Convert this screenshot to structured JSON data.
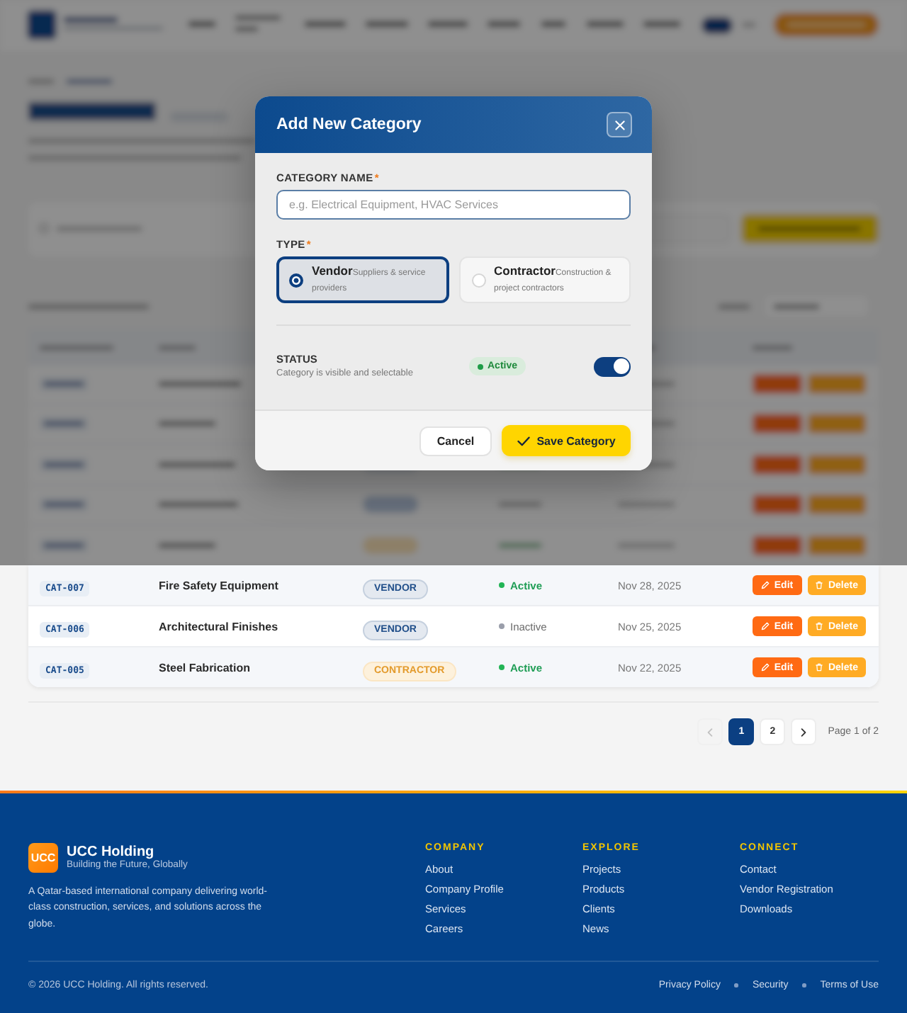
{
  "modal": {
    "title": "Add New Category",
    "name_field": {
      "label": "CATEGORY NAME",
      "required_mark": "*",
      "placeholder": "e.g. Electrical Equipment, HVAC Services"
    },
    "type_field": {
      "label": "TYPE",
      "required_mark": "*",
      "options": [
        {
          "title": "Vendor",
          "description": "Suppliers & service providers",
          "selected": true
        },
        {
          "title": "Contractor",
          "description": "Construction & project contractors",
          "selected": false
        }
      ]
    },
    "status": {
      "label": "STATUS",
      "hint": "Category is visible and selectable",
      "badge": "Active",
      "on": true
    },
    "buttons": [
      {
        "label": "Cancel",
        "kind": "secondary"
      },
      {
        "label": "Save Category",
        "kind": "primary"
      }
    ]
  },
  "table": {
    "rows": [
      {
        "id": "CAT-007",
        "name": "Fire Safety Equipment",
        "type": {
          "label": "VENDOR",
          "kind": "vendor"
        },
        "status": {
          "label": "Active",
          "active": true
        },
        "created": "Nov 28, 2025",
        "actions": [
          {
            "label": "Edit",
            "kind": "edit"
          },
          {
            "label": "Delete",
            "kind": "delete"
          }
        ]
      },
      {
        "id": "CAT-006",
        "name": "Architectural Finishes",
        "type": {
          "label": "VENDOR",
          "kind": "vendor"
        },
        "status": {
          "label": "Inactive",
          "active": false
        },
        "created": "Nov 25, 2025",
        "actions": [
          {
            "label": "Edit",
            "kind": "edit"
          },
          {
            "label": "Delete",
            "kind": "delete"
          }
        ]
      },
      {
        "id": "CAT-005",
        "name": "Steel Fabrication",
        "type": {
          "label": "CONTRACTOR",
          "kind": "contractor"
        },
        "status": {
          "label": "Active",
          "active": true
        },
        "created": "Nov 22, 2025",
        "actions": [
          {
            "label": "Edit",
            "kind": "edit"
          },
          {
            "label": "Delete",
            "kind": "delete"
          }
        ]
      }
    ]
  },
  "pagination": {
    "previous": {
      "disabled": true
    },
    "pages": [
      {
        "label": "1",
        "selected": true
      },
      {
        "label": "2",
        "selected": false
      }
    ],
    "next": {
      "disabled": false
    },
    "summary": "Page 1 of 2"
  },
  "footer": {
    "brand": {
      "logo": "UCC",
      "name": "UCC Holding",
      "tagline": "Building the Future, Globally"
    },
    "description": "A Qatar-based international company delivering world-class construction, services, and solutions across the globe.",
    "columns": [
      {
        "title": "COMPANY",
        "links": [
          "About",
          "Company Profile",
          "Services",
          "Careers"
        ]
      },
      {
        "title": "EXPLORE",
        "links": [
          "Projects",
          "Products",
          "Clients",
          "News"
        ]
      },
      {
        "title": "CONNECT",
        "links": [
          "Contact",
          "Vendor Registration",
          "Downloads"
        ]
      }
    ],
    "copyright": "© 2026 UCC Holding. All rights reserved.",
    "legal_links": [
      "Privacy Policy",
      "Security",
      "Terms of Use"
    ]
  }
}
